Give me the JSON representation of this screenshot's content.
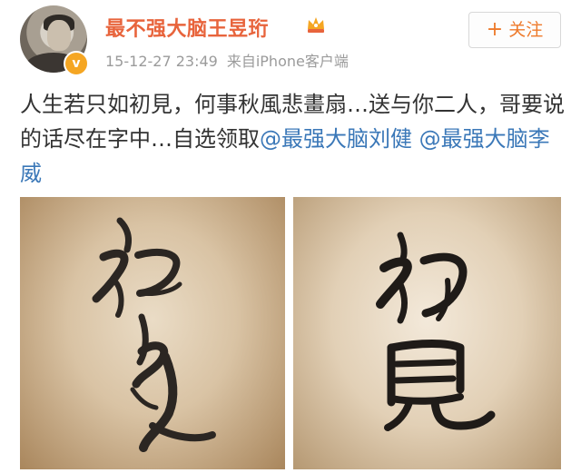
{
  "post": {
    "username": "最不强大脑王昱珩",
    "timestamp": "15-12-27 23:49",
    "source": "来自iPhone客户端",
    "follow_label": "关注",
    "follow_plus": "+",
    "text_main": "人生若只如初見，何事秋風悲畫扇…送与你二人，哥要说的话尽在字中…自选领取",
    "mentions": [
      "@最强大脑刘健",
      "@最强大脑李威"
    ]
  },
  "icons": {
    "verified_badge": "v-badge-icon",
    "vip": "crown-icon"
  },
  "colors": {
    "username": "#e8643c",
    "mention": "#3b78b8",
    "follow": "#ee7a2b",
    "meta": "#9b9b9b"
  }
}
